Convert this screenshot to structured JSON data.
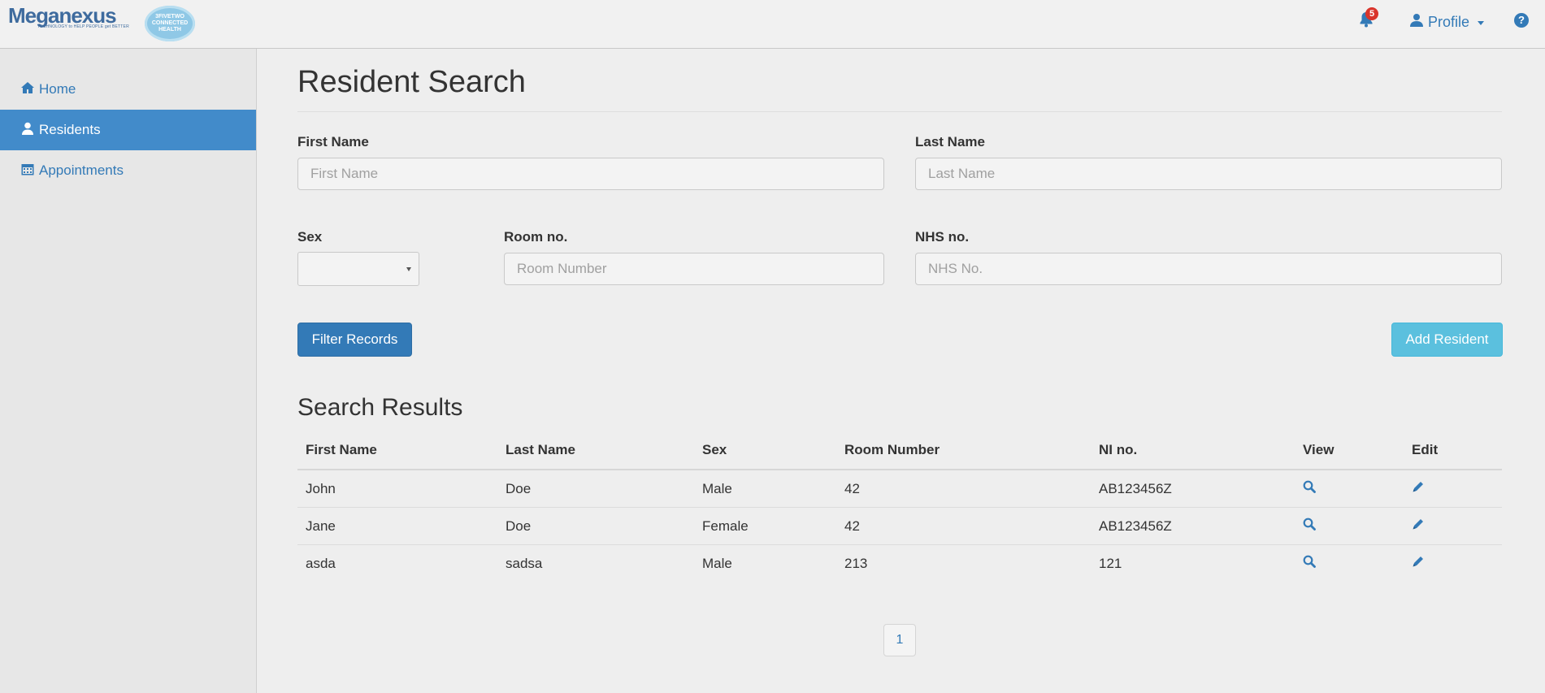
{
  "brand": {
    "name": "Meganexus",
    "tagline": "TECHNOLOGY to HELP PEOPLE get BETTER",
    "partner_badge": "3FIVETWO CONNECTED HEALTH"
  },
  "topbar": {
    "notifications_count": "5",
    "profile_label": "Profile",
    "help_symbol": "?"
  },
  "sidebar": {
    "items": [
      {
        "label": "Home",
        "icon": "home-icon",
        "active": false
      },
      {
        "label": "Residents",
        "icon": "user-icon",
        "active": true
      },
      {
        "label": "Appointments",
        "icon": "calendar-icon",
        "active": false
      }
    ]
  },
  "search_form": {
    "title": "Resident Search",
    "first_name": {
      "label": "First Name",
      "placeholder": "First Name",
      "value": ""
    },
    "last_name": {
      "label": "Last Name",
      "placeholder": "Last Name",
      "value": ""
    },
    "sex": {
      "label": "Sex",
      "value": ""
    },
    "room": {
      "label": "Room no.",
      "placeholder": "Room Number",
      "value": ""
    },
    "nhs": {
      "label": "NHS no.",
      "placeholder": "NHS No.",
      "value": ""
    },
    "filter_button": "Filter Records",
    "add_button": "Add Resident"
  },
  "results": {
    "title": "Search Results",
    "columns": [
      "First Name",
      "Last Name",
      "Sex",
      "Room Number",
      "NI no.",
      "View",
      "Edit"
    ],
    "rows": [
      {
        "first": "John",
        "last": "Doe",
        "sex": "Male",
        "room": "42",
        "ni": "AB123456Z"
      },
      {
        "first": "Jane",
        "last": "Doe",
        "sex": "Female",
        "room": "42",
        "ni": "AB123456Z"
      },
      {
        "first": "asda",
        "last": "sadsa",
        "sex": "Male",
        "room": "213",
        "ni": "121"
      }
    ],
    "pagination": {
      "current_page": "1"
    }
  },
  "colors": {
    "accent": "#337ab7",
    "active_nav": "#428bca",
    "info_button": "#5bc0de",
    "badge": "#d9342b"
  }
}
